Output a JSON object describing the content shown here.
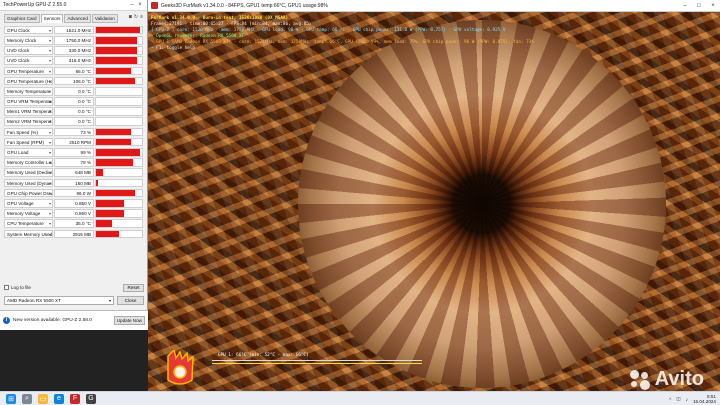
{
  "gpuz": {
    "title": "TechPowerUp GPU-Z 2.55.0",
    "tabs": [
      "Graphics Card",
      "Sensors",
      "Advanced",
      "Validation"
    ],
    "active_tab": "Sensors",
    "sensors": [
      {
        "name": "GPU Clock",
        "value": "1521.0 MHz",
        "fill": 0.95
      },
      {
        "name": "Memory Clock",
        "value": "1750.0 MHz",
        "fill": 0.9
      },
      {
        "name": "UVD Clock",
        "value": "330.0 MHz",
        "fill": 0.9
      },
      {
        "name": "UVD Clock",
        "value": "316.0 MHz",
        "fill": 0.9
      },
      {
        "name": "GPU Temperature",
        "value": "66.0 °C",
        "fill": 0.75
      },
      {
        "name": "GPU Temperature (Hot Spot)",
        "value": "106.0 °C",
        "fill": 0.85
      },
      {
        "name": "Memory Temperature",
        "value": "0.0 °C",
        "fill": 0
      },
      {
        "name": "GPU VRM Temperature",
        "value": "0.0 °C",
        "fill": 0
      },
      {
        "name": "Mem1 VRM Temperature",
        "value": "0.0 °C",
        "fill": 0
      },
      {
        "name": "Mem2 VRM Temperature",
        "value": "0.0 °C",
        "fill": 0
      },
      {
        "name": "Fan Speed (%)",
        "value": "73 %",
        "fill": 0.75
      },
      {
        "name": "Fan Speed (RPM)",
        "value": "2510 RPM",
        "fill": 0.75
      },
      {
        "name": "GPU Load",
        "value": "99 %",
        "fill": 0.95
      },
      {
        "name": "Memory Controller Load",
        "value": "78 %",
        "fill": 0.8
      },
      {
        "name": "Memory Used (Dedicated)",
        "value": "648 MB",
        "fill": 0.15
      },
      {
        "name": "Memory Used (Dynamic)",
        "value": "160 MB",
        "fill": 0.05
      },
      {
        "name": "GPU Chip Power Draw",
        "value": "96.0 W",
        "fill": 0.85
      },
      {
        "name": "GPU Voltage",
        "value": "0.850 V",
        "fill": 0.6
      },
      {
        "name": "Memory Voltage",
        "value": "0.850 V",
        "fill": 0.6
      },
      {
        "name": "CPU Temperature",
        "value": "35.0 °C",
        "fill": 0.35
      },
      {
        "name": "System Memory Used",
        "value": "2915 MB",
        "fill": 0.5
      }
    ],
    "log_to_file": "Log to file",
    "reset": "Reset",
    "gpu_select": "AMD Radeon RX 5500 XT",
    "close": "Close",
    "update_msg": "New version available: GPU-Z 2.58.0",
    "update_btn": "Update Now",
    "colors": {
      "graph": "#e01818"
    }
  },
  "furmark": {
    "title": "Geeks3D FurMark v1.34.0.0 - 84FPS, GPU1 temp:66°C, GPU1 usage:98%",
    "overlay": [
      "FurMark v1.34.0.0 - Burn-in test, 1536x1088 (0X MSAA)",
      "Frames:27191 - time:00:05:27 - FPS:84 (min:84, max:86, avg:85)",
      "[ GPU-Z ] core: 1520 MHz - mem: 1750 MHz - GPU load: 98 % - GPU temp: 66 °C - GPU chip power: 111.0 W (PPW: 0.757) - GPU voltage: 0.925 V",
      "- OpenGL renderer: Radeon RX 5500 XT",
      "- GPU 1 (AMD Radeon RX 5500 XT) - core: 1521MHz, mem: 1750MHz, temp: 66°C, GPU load: 99%, mem load: 79%, GPU chip power: 96 W (PPW: 0.875), fan: 73%",
      "- F1: toggle help"
    ],
    "graph_label": "GPU 1: 66°C (min: 52°C - max: 66°C)",
    "colors": {
      "overlay_title": "#ffe14a",
      "graph_line": "#ffd83a"
    }
  },
  "watermark": "Avito",
  "taskbar": {
    "time": "8:51",
    "date": "15.04.2024"
  }
}
